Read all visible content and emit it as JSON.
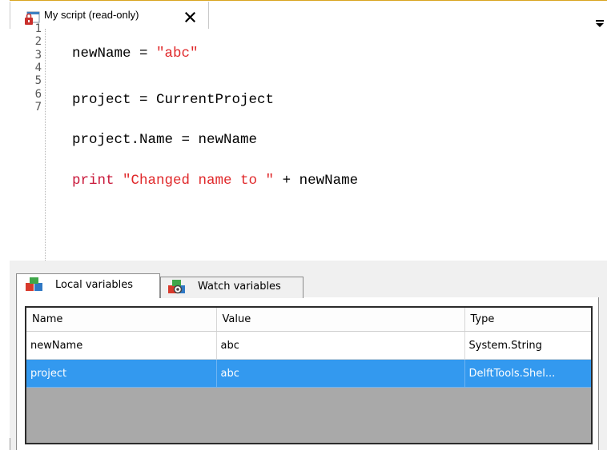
{
  "document_tab": {
    "title": "My script (read-only)",
    "close_glyph": "✕",
    "icon": "locked-script-icon"
  },
  "editor": {
    "lines": [
      {
        "number": "1",
        "parts": [
          {
            "text": "newName = ",
            "style": "plain"
          },
          {
            "text": "\"abc\"",
            "style": "string"
          }
        ]
      },
      {
        "number": "2",
        "parts": []
      },
      {
        "number": "3",
        "parts": [
          {
            "text": "project = CurrentProject",
            "style": "plain"
          }
        ]
      },
      {
        "number": "4",
        "parts": []
      },
      {
        "number": "5",
        "parts": [
          {
            "text": "project.Name = newName",
            "style": "plain"
          }
        ]
      },
      {
        "number": "6",
        "parts": []
      },
      {
        "number": "7",
        "parts": [
          {
            "text": "print",
            "style": "keyword"
          },
          {
            "text": " ",
            "style": "plain"
          },
          {
            "text": "\"Changed name to \"",
            "style": "string"
          },
          {
            "text": " + newName",
            "style": "plain"
          }
        ]
      }
    ]
  },
  "variables_panel": {
    "tabs": [
      {
        "label": "Local variables",
        "active": true,
        "icon": "local-variables-icon"
      },
      {
        "label": "Watch variables",
        "active": false,
        "icon": "watch-variables-icon"
      }
    ],
    "columns": [
      "Name",
      "Value",
      "Type"
    ],
    "rows": [
      {
        "name": "newName",
        "value": "abc",
        "type": "System.String",
        "selected": false
      },
      {
        "name": "project",
        "value": "abc",
        "type": "DelftTools.Shel...",
        "selected": true
      }
    ]
  },
  "colors": {
    "string": "#e0282a",
    "keyword": "#c9183a",
    "selection": "#3399ef"
  }
}
